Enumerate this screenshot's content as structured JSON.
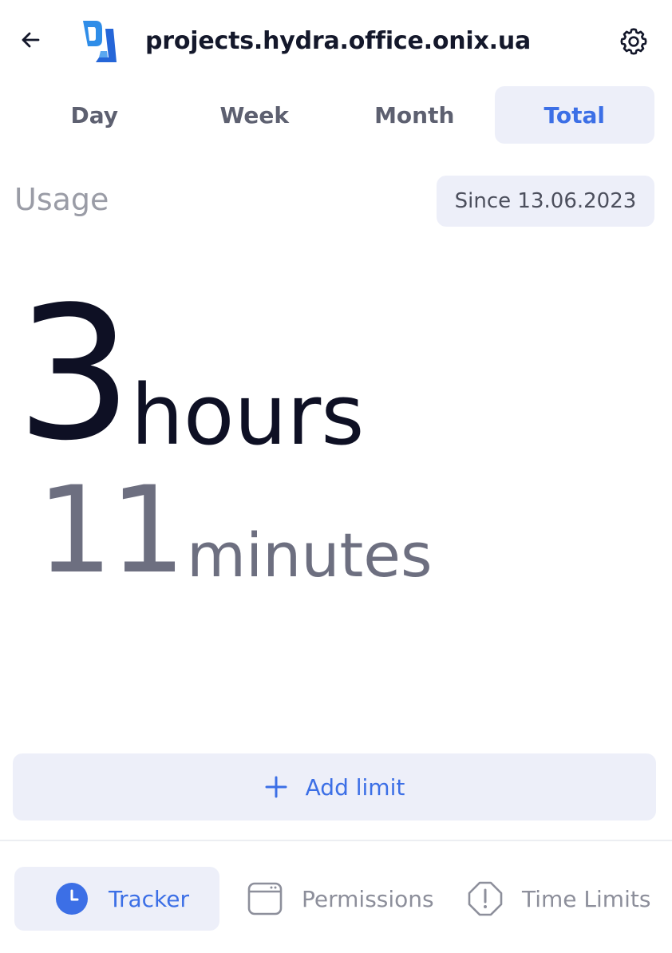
{
  "header": {
    "site_title": "projects.hydra.office.onix.ua",
    "back_icon": "arrow-left-icon",
    "settings_icon": "gear-icon"
  },
  "tabs": [
    {
      "label": "Day",
      "active": false
    },
    {
      "label": "Week",
      "active": false
    },
    {
      "label": "Month",
      "active": false
    },
    {
      "label": "Total",
      "active": true
    }
  ],
  "usage": {
    "label": "Usage",
    "since": "Since 13.06.2023"
  },
  "time": {
    "hours_value": "3",
    "hours_unit": "hours",
    "minutes_value": "11",
    "minutes_unit": "minutes"
  },
  "add_limit": {
    "label": "Add limit",
    "icon": "plus-icon"
  },
  "bottom_nav": [
    {
      "label": "Tracker",
      "icon": "clock-icon",
      "active": true
    },
    {
      "label": "Permissions",
      "icon": "browser-window-icon",
      "active": false
    },
    {
      "label": "Time Limits",
      "icon": "alert-octagon-icon",
      "active": false
    }
  ],
  "colors": {
    "accent": "#3c6fe6",
    "accent_bg": "#edeff9",
    "text_dark": "#0e1024",
    "text_muted": "#6d6f80"
  }
}
